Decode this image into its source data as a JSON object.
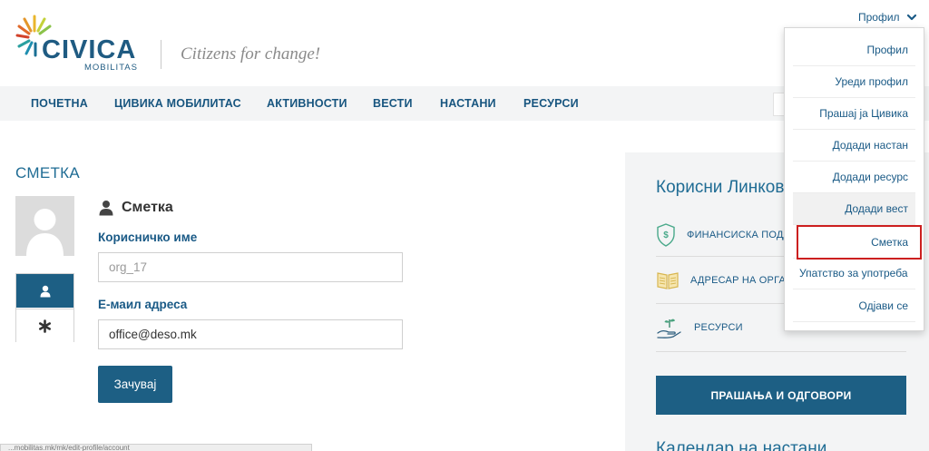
{
  "header": {
    "logo_name": "CIVICA",
    "logo_sub": "MOBILITAS",
    "tagline": "Citizens for change!",
    "profile_toggle": "Профил"
  },
  "nav": {
    "items": [
      {
        "label": "ПОЧЕТНА"
      },
      {
        "label": "ЦИВИКА МОБИЛИТАС"
      },
      {
        "label": "АКТИВНОСТИ"
      },
      {
        "label": "ВЕСТИ"
      },
      {
        "label": "НАСТАНИ"
      },
      {
        "label": "РЕСУРСИ"
      }
    ]
  },
  "main": {
    "section_title": "СМЕТКА",
    "card_title": "Сметка",
    "username_label": "Корисничко име",
    "username_value": "org_17",
    "email_label": "Е-маил адреса",
    "email_value": "office@deso.mk",
    "save_label": "Зачувај"
  },
  "sidebar": {
    "title": "Корисни Линкови",
    "links": [
      {
        "label": "ФИНАНСИСКА ПОДДРШКА",
        "icon": "shield-dollar-icon"
      },
      {
        "label": "АДРЕСАР НА ОРГАНИЗАЦИИ",
        "icon": "open-book-icon"
      },
      {
        "label": "РЕСУРСИ",
        "icon": "hand-plant-icon"
      }
    ],
    "faq_label": "ПРАШАЊА И ОДГОВОРИ",
    "calendar_title": "Календар на настани"
  },
  "dropdown": {
    "items": [
      {
        "label": "Профил"
      },
      {
        "label": "Уреди профил"
      },
      {
        "label": "Прашај ја Цивика"
      },
      {
        "label": "Додади настан"
      },
      {
        "label": "Додади ресурс"
      },
      {
        "label": "Додади вест"
      },
      {
        "label": "Сметка"
      },
      {
        "label": "Упатство за употреба"
      },
      {
        "label": "Одјави се"
      }
    ]
  },
  "statusbar": {
    "url": "...mobilitas.mk/mk/edit-profile/account"
  },
  "colors": {
    "primary": "#1d5f84",
    "link": "#1a5a86",
    "highlight_border": "#cc1f1f",
    "sidebar_bg": "#f3f4f5"
  }
}
